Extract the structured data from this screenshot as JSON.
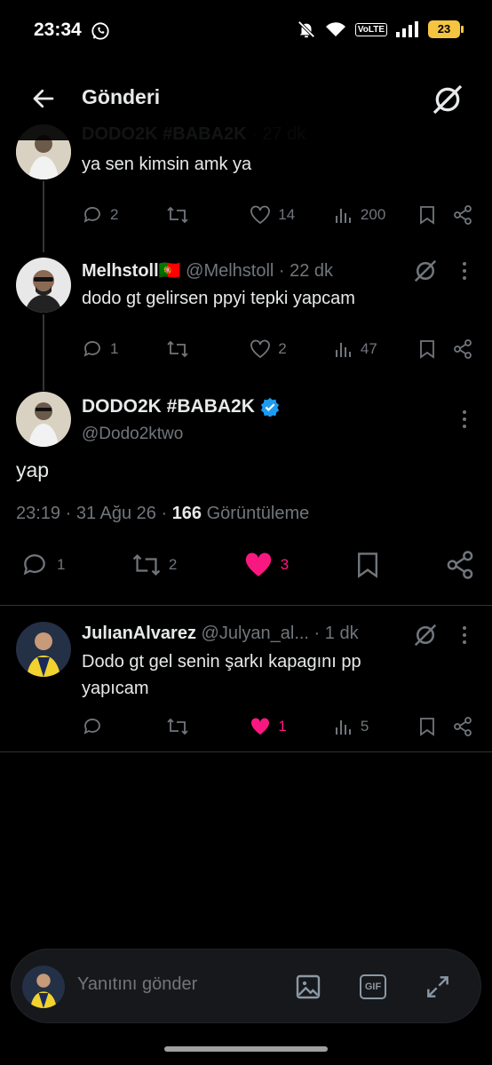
{
  "status": {
    "time": "23:34",
    "volte": "VoLTE",
    "battery": "23"
  },
  "header": {
    "title": "Gönderi"
  },
  "tweets": [
    {
      "name": "DODO2K #BABA2K",
      "handle": "· 27 dk",
      "text": "ya sen kimsin amk ya",
      "replies": "2",
      "retweets": "",
      "likes": "14",
      "views": "200"
    },
    {
      "name": "Melhstoll🇵🇹",
      "handle": "@Melhstoll · 22 dk",
      "text": "dodo gt gelirsen ppyi tepki yapcam",
      "replies": "1",
      "retweets": "",
      "likes": "2",
      "views": "47"
    }
  ],
  "main_tweet": {
    "name": "DODO2K #BABA2K",
    "handle": "@Dodo2ktwo",
    "text": "yap",
    "meta_time": "23:19 · 31 Ağu 26 · ",
    "views_count": "166",
    "views_label": " Görüntüleme",
    "replies": "1",
    "retweets": "2",
    "likes": "3"
  },
  "reply": {
    "name": "JulıanAlvarez",
    "handle": "@Julyan_al... · 1 dk",
    "text_line1": "Dodo gt gel senin şarkı kapagını pp",
    "text_line2": "yapıcam",
    "replies": "",
    "retweets": "",
    "likes": "1",
    "views": "5"
  },
  "reply_bar": {
    "placeholder": "Yanıtını gönder",
    "gif_label": "GIF"
  },
  "colors": {
    "like": "#f91880",
    "verified": "#1d9bf0",
    "muted": "#71767b",
    "background": "#000000"
  }
}
